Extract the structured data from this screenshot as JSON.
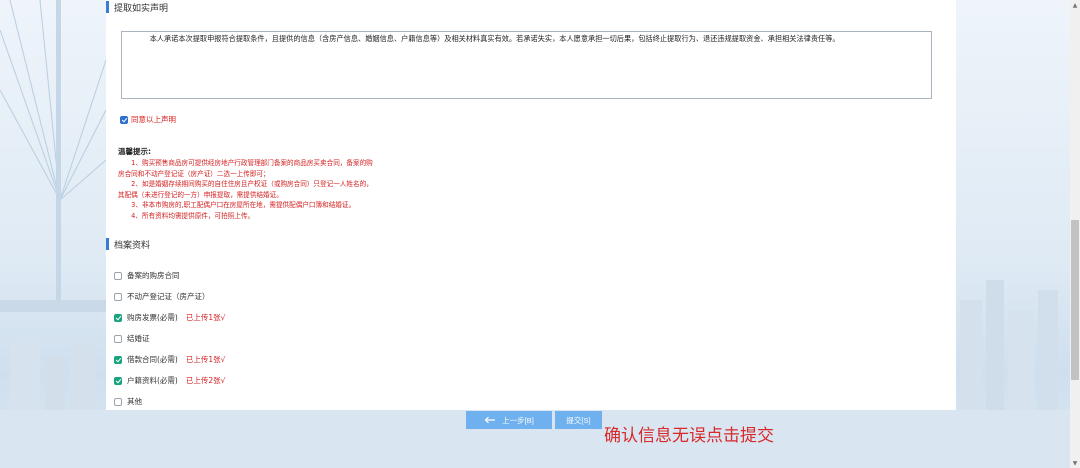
{
  "declaration": {
    "section_title": "提取如实声明",
    "text": "　　　本人承诺本次提取申报符合提取条件，且提供的信息（含房产信息、婚姻信息、户籍信息等）及相关材料真实有效。若承诺失实，本人愿意承担一切后果，包括终止提取行为、退还违规提取资金、承担相关法律责任等。",
    "agree_label": "同意以上声明"
  },
  "tips": {
    "title": "温馨提示:",
    "lines": [
      "　　1、购买预售商品房可提供经房地产行政管理部门备案的商品房买卖合同，备案的购",
      "房合同和不动产登记证（房产证）二选一上传即可；",
      "　　2、如是婚姻存续期间购买的自住住房且产权证（或购房合同）只登记一人姓名的，",
      "其配偶（未进行登记的一方）申报提取，需提供结婚证。",
      "　　3、非本市购房的,职工配偶户口在房屋所在地，需提供配偶户口簿和结婚证。",
      "　　4、所有资料均需提供原件，可拍照上传。"
    ]
  },
  "files": {
    "section_title": "档案资料",
    "items": [
      {
        "label": "备案的购房合同",
        "checked": false,
        "status": ""
      },
      {
        "label": "不动产登记证（房产证）",
        "checked": false,
        "status": ""
      },
      {
        "label": "购房发票(必需)",
        "checked": true,
        "status": "已上传1张√"
      },
      {
        "label": "结婚证",
        "checked": false,
        "status": ""
      },
      {
        "label": "借款合同(必需)",
        "checked": true,
        "status": "已上传1张√"
      },
      {
        "label": "户籍资料(必需)",
        "checked": true,
        "status": "已上传2张√"
      },
      {
        "label": "其他",
        "checked": false,
        "status": ""
      }
    ]
  },
  "buttons": {
    "prev_label": "上一步[B]",
    "submit_label": "提交[S]"
  },
  "annotation": "确认信息无误点击提交",
  "colors": {
    "accent": "#3a7bd5",
    "check": "#1aa37f",
    "warning": "#d42020",
    "button": "#6fb0ee"
  }
}
